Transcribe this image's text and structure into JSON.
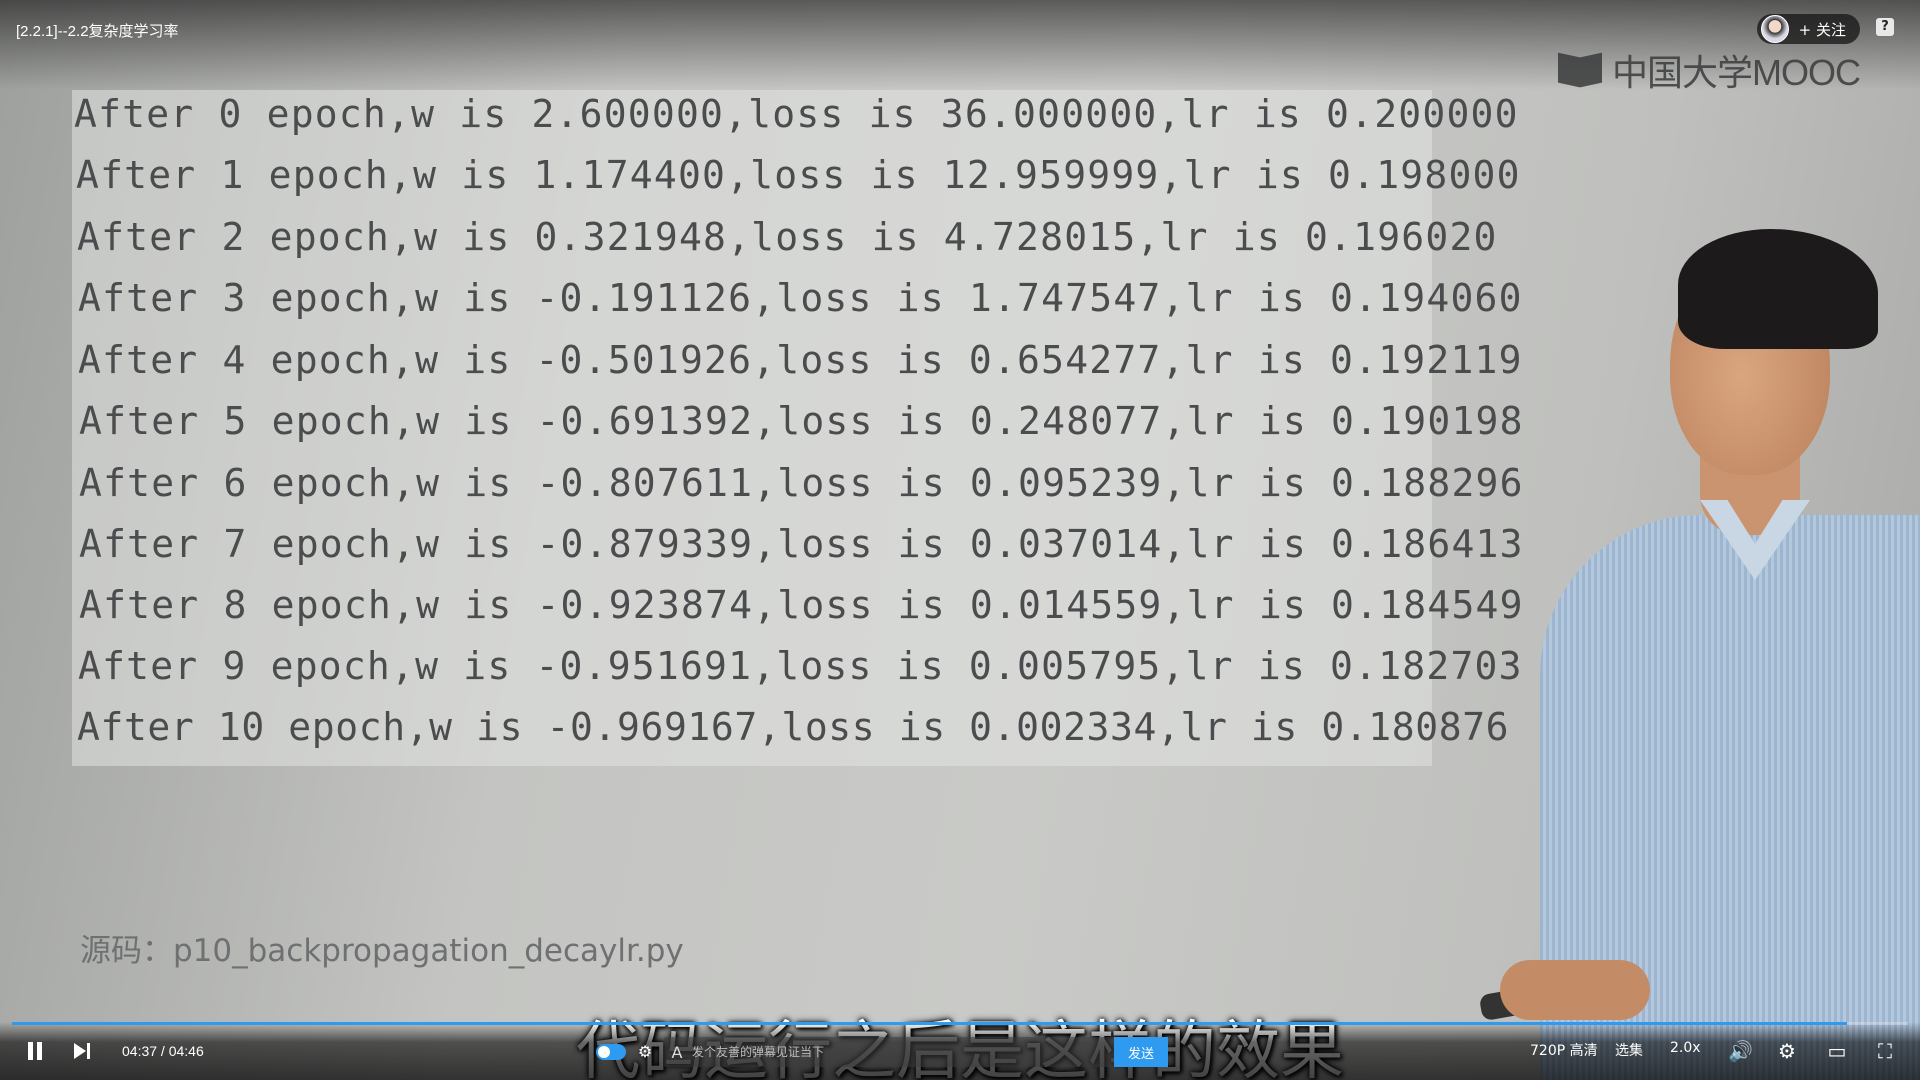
{
  "video": {
    "title": "[2.2.1]--2.2复杂度学习率",
    "follow_label": "+ 关注",
    "help_label": "?",
    "logo_text": "中国大学MOOC"
  },
  "slide": {
    "lines": [
      "After 0 epoch,w is 2.600000,loss is 36.000000,lr is 0.200000",
      "After 1 epoch,w is 1.174400,loss is 12.959999,lr is 0.198000",
      "After 2 epoch,w is 0.321948,loss is 4.728015,lr is 0.196020",
      "After 3 epoch,w is -0.191126,loss is 1.747547,lr is 0.194060",
      "After 4 epoch,w is -0.501926,loss is 0.654277,lr is 0.192119",
      "After 5 epoch,w is -0.691392,loss is 0.248077,lr is 0.190198",
      "After 6 epoch,w is -0.807611,loss is 0.095239,lr is 0.188296",
      "After 7 epoch,w is -0.879339,loss is 0.037014,lr is 0.186413",
      "After 8 epoch,w is -0.923874,loss is 0.014559,lr is 0.184549",
      "After 9 epoch,w is -0.951691,loss is 0.005795,lr is 0.182703",
      "After 10 epoch,w is -0.969167,loss is 0.002334,lr is 0.180876"
    ],
    "source": "源码：p10_backpropagation_decaylr.py"
  },
  "subtitle": "代码运行之后是这样的效果",
  "player": {
    "current_time": "04:37",
    "duration": "04:46",
    "time_display": "04:37 / 04:46",
    "progress_fraction": 0.968,
    "danmu_toggle_label": "弹",
    "danmu_placeholder": "发个友善的弹幕见证当下",
    "send_label": "发送",
    "quality_label": "720P 高清",
    "episodes_label": "选集",
    "speed_label": "2.0x",
    "accent_color": "#2e9bf0"
  }
}
